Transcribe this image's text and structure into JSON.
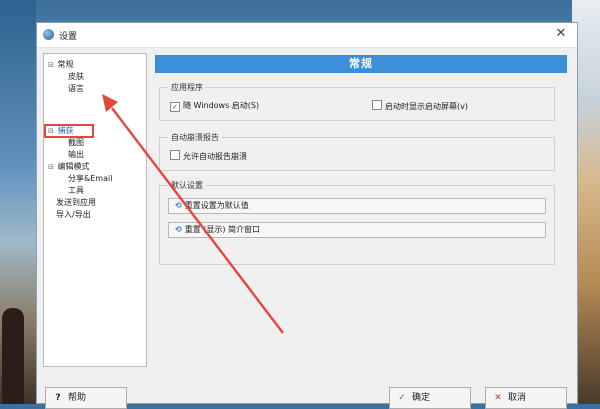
{
  "window": {
    "title": "设置",
    "close_glyph": "✕"
  },
  "tree": {
    "items": [
      {
        "label": "常规",
        "expander": "⊟"
      },
      {
        "label": "皮肤"
      },
      {
        "label": "语言"
      },
      {
        "label": "捕获",
        "expander": "⊟",
        "selected": true
      },
      {
        "label": "截图"
      },
      {
        "label": "输出"
      },
      {
        "label": "编辑模式",
        "expander": "⊟"
      },
      {
        "label": "分享&Email"
      },
      {
        "label": "工具"
      },
      {
        "label": "发送到应用"
      },
      {
        "label": "导入/导出"
      }
    ]
  },
  "content": {
    "header": "常规",
    "groups": {
      "app": {
        "label": "应用程序",
        "checks": [
          {
            "label": "随 Windows 启动(S)",
            "checked": true,
            "mark": "✓"
          },
          {
            "label": "启动时显示启动屏幕(v)",
            "checked": false,
            "mark": ""
          }
        ]
      },
      "error": {
        "label": "自动崩溃报告",
        "checks": [
          {
            "label": "允许自动报告崩溃",
            "checked": false,
            "mark": ""
          }
        ]
      },
      "defaults": {
        "label": "默认设置",
        "buttons": [
          "重置设置为默认值",
          "重置 (显示) 简介窗口"
        ],
        "button_icon": "⟲"
      }
    }
  },
  "footer": {
    "help": "帮助",
    "ok": "确定",
    "cancel": "取消",
    "help_icon": "?",
    "ok_icon": "✓",
    "cancel_icon": "✕"
  },
  "colors": {
    "accent": "#3c8fd8",
    "annotation": "#e3483f"
  }
}
